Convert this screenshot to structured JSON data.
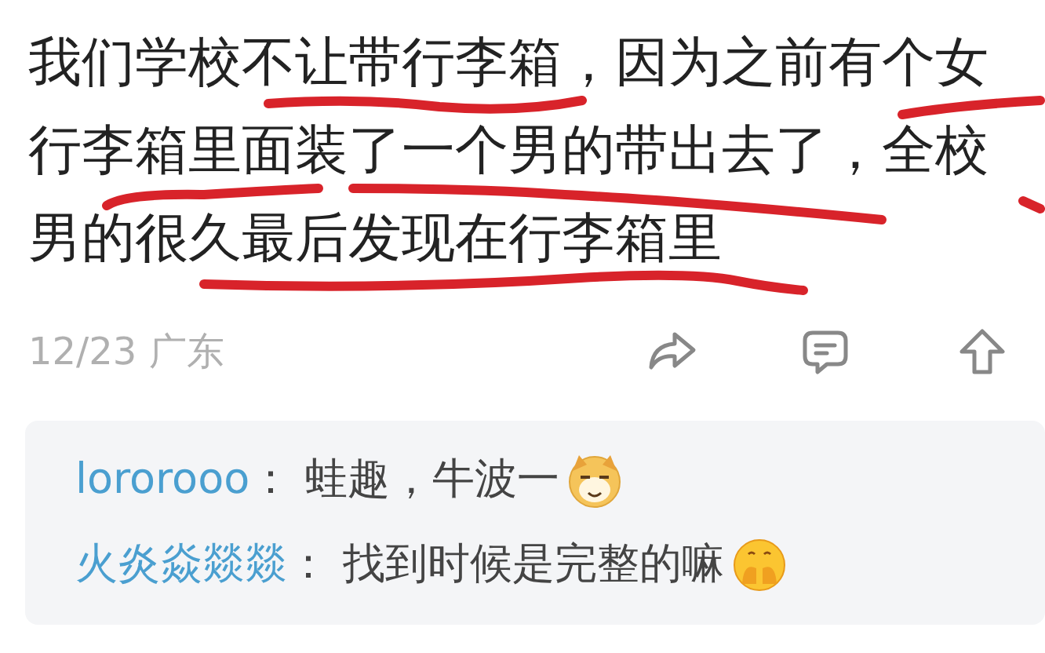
{
  "post": {
    "lines": [
      "我们学校不让带行李箱，因为之前有个女",
      "行李箱里面装了一个男的带出去了，全校",
      "男的很久最后发现在行李箱里"
    ],
    "meta": "12/23 广东"
  },
  "replies": [
    {
      "user": "lororooo",
      "separator": "：",
      "text": "蛙趣，牛波一",
      "kind": "dog"
    },
    {
      "user": "火炎焱燚燚",
      "separator": "：",
      "text": "找到时候是完整的嘛",
      "kind": "cover"
    }
  ]
}
